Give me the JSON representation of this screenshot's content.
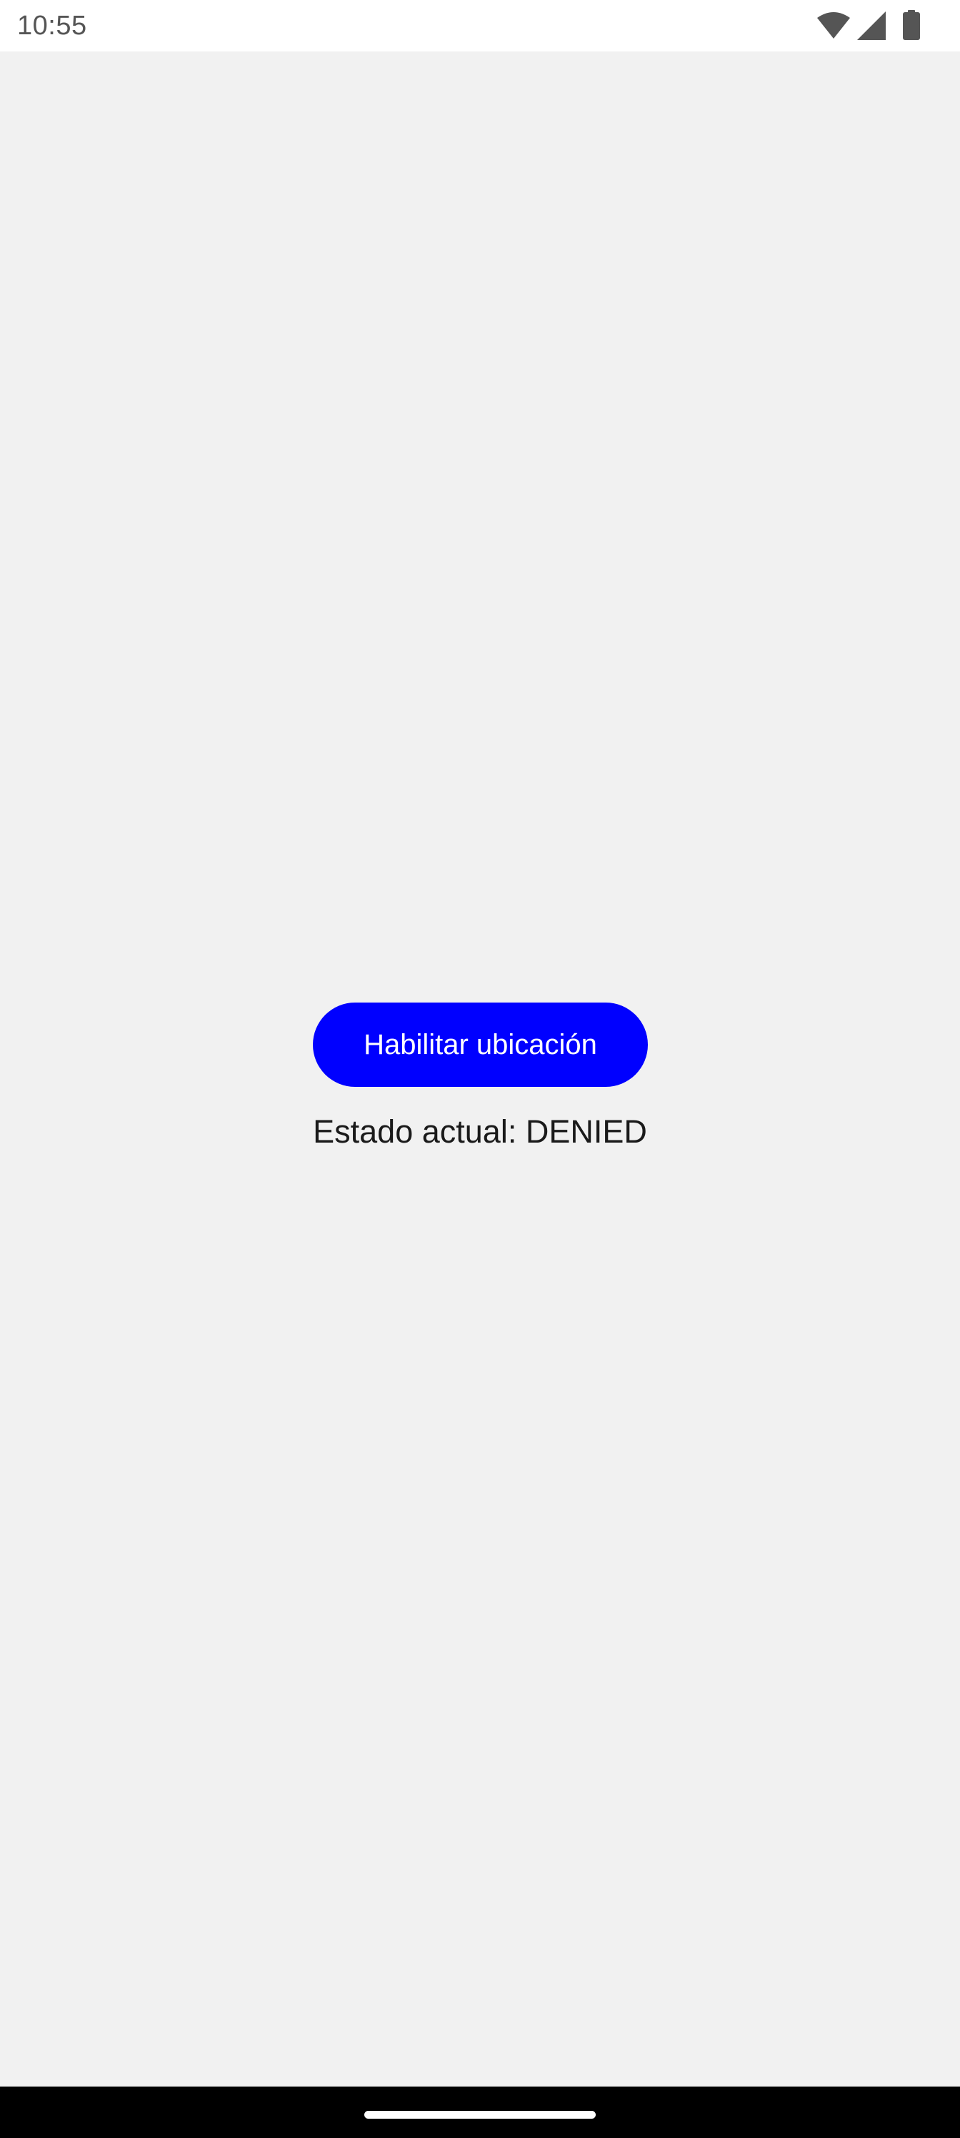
{
  "status_bar": {
    "time": "10:55",
    "icons": [
      "wifi-icon",
      "signal-icon",
      "battery-icon"
    ],
    "icon_color": "#555555"
  },
  "main": {
    "enable_button_label": "Habilitar ubicación",
    "status_text": "Estado actual: DENIED",
    "accent_color": "#0000ff"
  },
  "nav_bar": {
    "gesture": "home-indicator"
  }
}
